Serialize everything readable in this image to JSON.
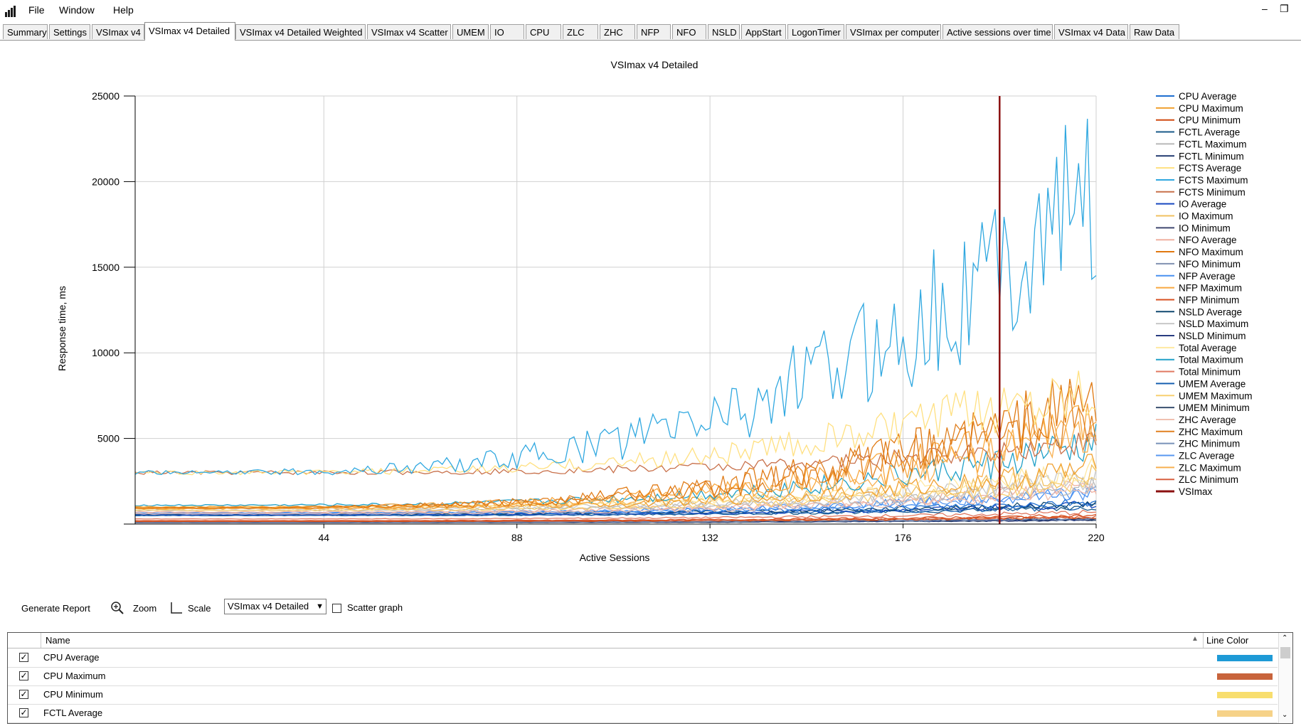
{
  "menu": {
    "items": [
      "File",
      "Window",
      "Help"
    ]
  },
  "window_controls": {
    "minimize": "–",
    "restore": "❐"
  },
  "tabs": [
    {
      "label": "Summary"
    },
    {
      "label": "Settings"
    },
    {
      "label": "VSImax v4"
    },
    {
      "label": "VSImax v4 Detailed",
      "active": true
    },
    {
      "label": "VSImax v4 Detailed Weighted"
    },
    {
      "label": "VSImax v4 Scatter"
    },
    {
      "label": "UMEM"
    },
    {
      "label": "IO"
    },
    {
      "label": "CPU"
    },
    {
      "label": "ZLC"
    },
    {
      "label": "ZHC"
    },
    {
      "label": "NFP"
    },
    {
      "label": "NFO"
    },
    {
      "label": "NSLD"
    },
    {
      "label": "AppStart"
    },
    {
      "label": "LogonTimer"
    },
    {
      "label": "VSImax per computer"
    },
    {
      "label": "Active sessions over time"
    },
    {
      "label": "VSImax v4 Data"
    },
    {
      "label": "Raw Data"
    }
  ],
  "chart_data": {
    "type": "line",
    "title": "VSImax v4 Detailed",
    "xlabel": "Active Sessions",
    "ylabel": "Response time, ms",
    "xlim": [
      1,
      220
    ],
    "ylim": [
      0,
      25000
    ],
    "xticks": [
      44,
      88,
      132,
      176,
      220
    ],
    "yticks": [
      5000,
      10000,
      15000,
      20000,
      25000
    ],
    "grid": true,
    "legend_position": "right",
    "vsimax_x": 198,
    "series": [
      {
        "name": "CPU Average",
        "color": "#1f6fd0",
        "base": 620,
        "growth": 700
      },
      {
        "name": "CPU Maximum",
        "color": "#f0a030",
        "base": 900,
        "growth": 2400
      },
      {
        "name": "CPU Minimum",
        "color": "#d04a10",
        "base": 150,
        "growth": 250
      },
      {
        "name": "FCTL Average",
        "color": "#1a5a8a",
        "base": 500,
        "growth": 500
      },
      {
        "name": "FCTL Maximum",
        "color": "#b8b8b8",
        "base": 800,
        "growth": 1500
      },
      {
        "name": "FCTL Minimum",
        "color": "#223a70",
        "base": 100,
        "growth": 200
      },
      {
        "name": "FCTS Average",
        "color": "#ffe080",
        "base": 3000,
        "growth": 5500
      },
      {
        "name": "FCTS Maximum",
        "color": "#30a8e0",
        "base": 3000,
        "growth": 17000
      },
      {
        "name": "FCTS Minimum",
        "color": "#c8704a",
        "base": 3000,
        "growth": 1800
      },
      {
        "name": "IO Average",
        "color": "#1848c0",
        "base": 550,
        "growth": 600
      },
      {
        "name": "IO Maximum",
        "color": "#f0c060",
        "base": 1000,
        "growth": 2000
      },
      {
        "name": "IO Minimum",
        "color": "#404870",
        "base": 80,
        "growth": 150
      },
      {
        "name": "NFO Average",
        "color": "#f0b0a0",
        "base": 700,
        "growth": 1500
      },
      {
        "name": "NFO Maximum",
        "color": "#e07810",
        "base": 950,
        "growth": 6500
      },
      {
        "name": "NFO Minimum",
        "color": "#8090b0",
        "base": 120,
        "growth": 200
      },
      {
        "name": "NFP Average",
        "color": "#4890f0",
        "base": 650,
        "growth": 1200
      },
      {
        "name": "NFP Maximum",
        "color": "#f8a840",
        "base": 1000,
        "growth": 5000
      },
      {
        "name": "NFP Minimum",
        "color": "#d85020",
        "base": 200,
        "growth": 300
      },
      {
        "name": "NSLD Average",
        "color": "#104870",
        "base": 600,
        "growth": 600
      },
      {
        "name": "NSLD Maximum",
        "color": "#c8c8c8",
        "base": 900,
        "growth": 1800
      },
      {
        "name": "NSLD Minimum",
        "color": "#283c80",
        "base": 100,
        "growth": 150
      },
      {
        "name": "Total Average",
        "color": "#ffe8a0",
        "base": 1000,
        "growth": 2200
      },
      {
        "name": "Total Maximum",
        "color": "#20a0c8",
        "base": 1100,
        "growth": 3500
      },
      {
        "name": "Total Minimum",
        "color": "#e07860",
        "base": 300,
        "growth": 400
      },
      {
        "name": "UMEM Average",
        "color": "#1860b0",
        "base": 500,
        "growth": 500
      },
      {
        "name": "UMEM Maximum",
        "color": "#f8d070",
        "base": 800,
        "growth": 1600
      },
      {
        "name": "UMEM Minimum",
        "color": "#3a5070",
        "base": 90,
        "growth": 150
      },
      {
        "name": "ZHC Average",
        "color": "#f0c0b0",
        "base": 600,
        "growth": 1400
      },
      {
        "name": "ZHC Maximum",
        "color": "#e08020",
        "base": 950,
        "growth": 6000
      },
      {
        "name": "ZHC Minimum",
        "color": "#7890b8",
        "base": 110,
        "growth": 180
      },
      {
        "name": "ZLC Average",
        "color": "#5898f0",
        "base": 630,
        "growth": 1200
      },
      {
        "name": "ZLC Maximum",
        "color": "#f8b050",
        "base": 900,
        "growth": 4500
      },
      {
        "name": "ZLC Minimum",
        "color": "#d86040",
        "base": 180,
        "growth": 250
      },
      {
        "name": "VSImax",
        "color": "#8b1010",
        "base": 0,
        "growth": 0
      }
    ]
  },
  "controls": {
    "generate_report": "Generate Report",
    "zoom": "Zoom",
    "scale": "Scale",
    "view_select": "VSImax v4 Detailed",
    "scatter_label": "Scatter graph",
    "scatter_checked": false
  },
  "grid": {
    "col_name": "Name",
    "col_color": "Line Color",
    "rows": [
      {
        "name": "CPU Average",
        "checked": true,
        "color": "#1e9ad6"
      },
      {
        "name": "CPU Maximum",
        "checked": true,
        "color": "#c8643c"
      },
      {
        "name": "CPU Minimum",
        "checked": true,
        "color": "#f8de6e"
      },
      {
        "name": "FCTL Average",
        "checked": true,
        "color": "#f6d288"
      }
    ]
  }
}
